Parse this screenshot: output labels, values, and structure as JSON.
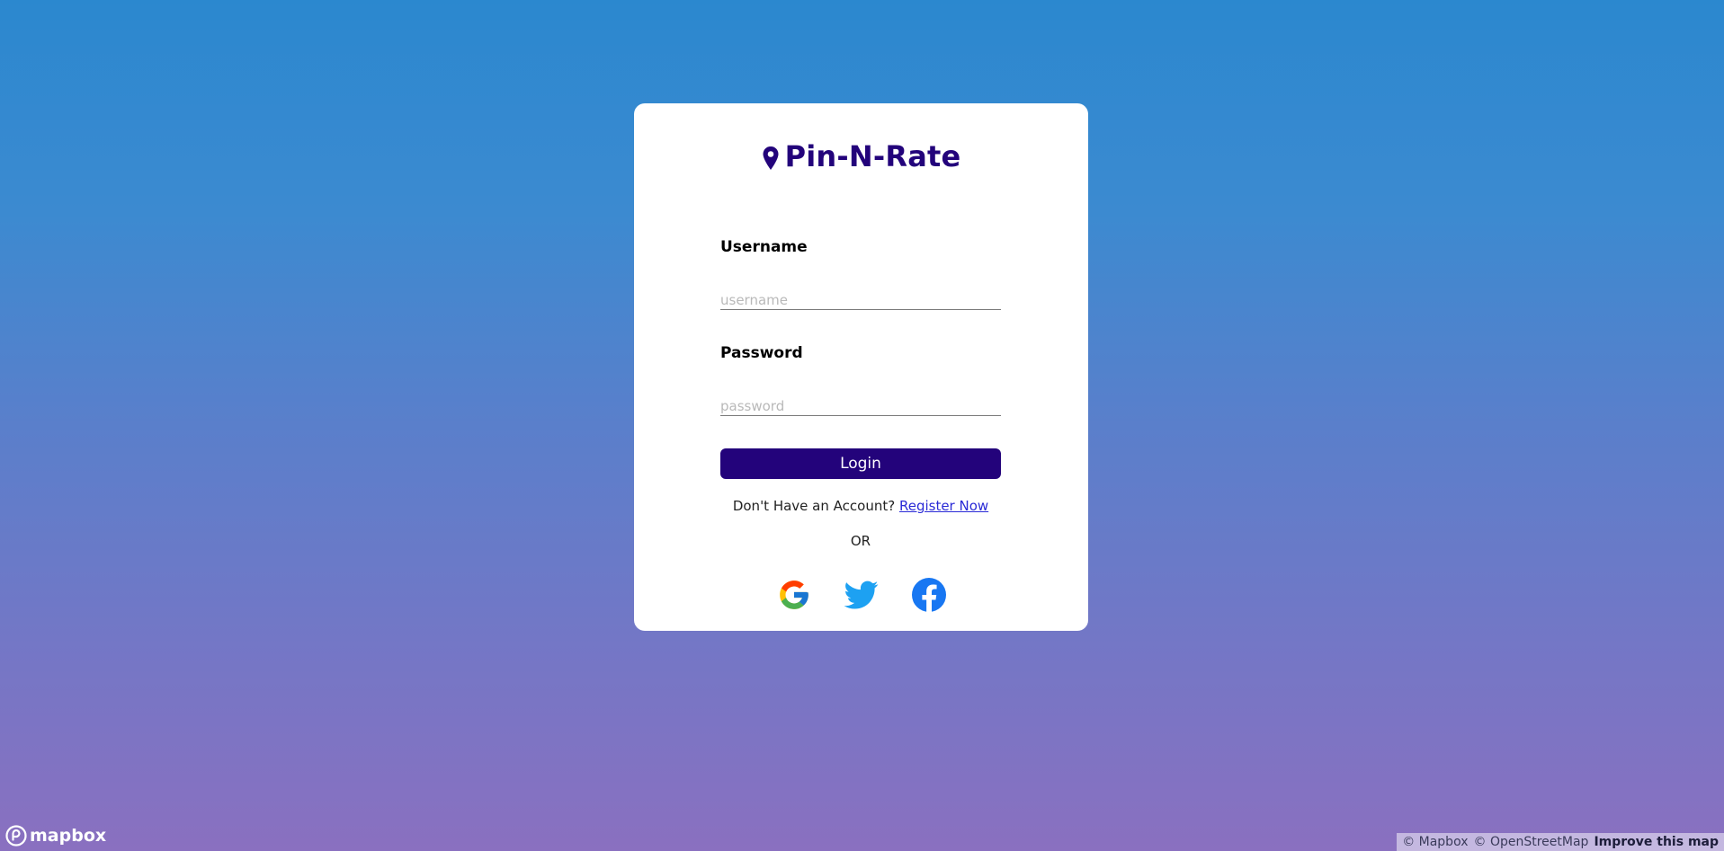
{
  "app": {
    "name": "Pin-N-Rate",
    "brand_color": "#23037b"
  },
  "login": {
    "username_label": "Username",
    "username_placeholder": "username",
    "password_label": "Password",
    "password_placeholder": "password",
    "login_button": "Login",
    "no_account_text": "Don't Have an Account?",
    "register_link": "Register Now",
    "or_text": "OR",
    "social": [
      {
        "name": "google-icon"
      },
      {
        "name": "twitter-icon",
        "color": "#1da1f2"
      },
      {
        "name": "facebook-icon",
        "color": "#1877f2"
      }
    ]
  },
  "map": {
    "logo_text": "mapbox",
    "attribution_mapbox": "© Mapbox",
    "attribution_osm": "© OpenStreetMap",
    "improve_link": "Improve this map"
  }
}
